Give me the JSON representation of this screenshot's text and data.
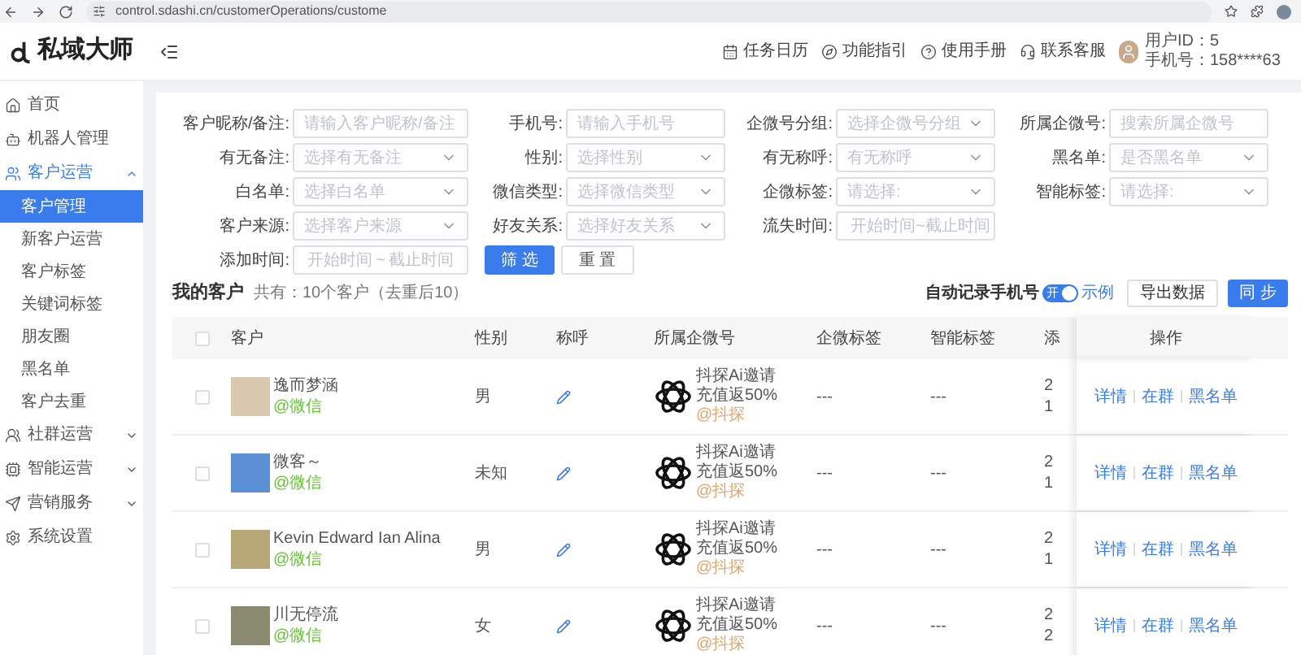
{
  "browser": {
    "url": "control.sdashi.cn/customerOperations/custome"
  },
  "header": {
    "logo": "私域大师",
    "links": [
      {
        "label": "任务日历"
      },
      {
        "label": "功能指引"
      },
      {
        "label": "使用手册"
      },
      {
        "label": "联系客服"
      }
    ],
    "user_id": "用户ID：5",
    "phone": "手机号：158****63"
  },
  "sidebar": {
    "items": [
      {
        "label": "首页",
        "selected": false
      },
      {
        "label": "机器人管理",
        "selected": false
      },
      {
        "label": "客户运营",
        "expanded": true,
        "selected": false,
        "children": [
          {
            "label": "客户管理",
            "selected": true
          },
          {
            "label": "新客户运营",
            "selected": false
          },
          {
            "label": "客户标签",
            "selected": false
          },
          {
            "label": "关键词标签",
            "selected": false
          },
          {
            "label": "朋友圈",
            "selected": false
          },
          {
            "label": "黑名单",
            "selected": false
          },
          {
            "label": "客户去重",
            "selected": false
          }
        ]
      },
      {
        "label": "社群运营",
        "expanded": false,
        "selected": false
      },
      {
        "label": "智能运营",
        "expanded": false,
        "selected": false
      },
      {
        "label": "营销服务",
        "expanded": false,
        "selected": false
      },
      {
        "label": "系统设置",
        "selected": false
      }
    ]
  },
  "filters": [
    [
      {
        "kind": "input",
        "label": "客户昵称/备注:",
        "placeholder": "请输入客户昵称/备注"
      },
      {
        "kind": "input",
        "label": "手机号:",
        "placeholder": "请输入手机号"
      },
      {
        "kind": "select",
        "label": "企微号分组:",
        "placeholder": "选择企微号分组"
      },
      {
        "kind": "input",
        "label": "所属企微号:",
        "placeholder": "搜索所属企微号"
      }
    ],
    [
      {
        "kind": "select",
        "label": "有无备注:",
        "placeholder": "选择有无备注"
      },
      {
        "kind": "select",
        "label": "性别:",
        "placeholder": "选择性别"
      },
      {
        "kind": "select",
        "label": "有无称呼:",
        "placeholder": "有无称呼"
      },
      {
        "kind": "select",
        "label": "黑名单:",
        "placeholder": "是否黑名单"
      }
    ],
    [
      {
        "kind": "select",
        "label": "白名单:",
        "placeholder": "选择白名单"
      },
      {
        "kind": "select",
        "label": "微信类型:",
        "placeholder": "选择微信类型"
      },
      {
        "kind": "select",
        "label": "企微标签:",
        "placeholder": "请选择:"
      },
      {
        "kind": "select",
        "label": "智能标签:",
        "placeholder": "请选择:"
      }
    ],
    [
      {
        "kind": "select",
        "label": "客户来源:",
        "placeholder": "选择客户来源"
      },
      {
        "kind": "select",
        "label": "好友关系:",
        "placeholder": "选择好友关系"
      },
      {
        "kind": "range",
        "label": "流失时间:",
        "start": "开始时间",
        "sep": "~",
        "end": "截止时间"
      }
    ],
    [
      {
        "kind": "range",
        "label": "添加时间:",
        "start": "开始时间",
        "sep": "~",
        "end": "截止时间"
      }
    ]
  ],
  "filter_buttons": {
    "search": "筛 选",
    "reset": "重 置"
  },
  "list": {
    "title": "我的客户",
    "count": "共有：10个客户（去重后10）",
    "auto_record": "自动记录手机号",
    "switch": {
      "on": true,
      "label": "开"
    },
    "example": "示例",
    "export": "导出数据",
    "sync": "同 步"
  },
  "table": {
    "select_all": {
      "checked": false
    },
    "columns": [
      "客户",
      "性别",
      "称呼",
      "所属企微号",
      "企微标签",
      "智能标签",
      "添",
      "操作"
    ],
    "rows": [
      {
        "checked": false,
        "name": "逸而梦涵",
        "source": "@微信",
        "gender": "男",
        "account": [
          "抖探Ai邀请",
          "充值返50%"
        ],
        "account_source": "@抖探",
        "wecom_tags": "---",
        "smart_tags": "---",
        "date": [
          "2",
          "1"
        ],
        "actions": [
          "详情",
          "在群",
          "黑名单"
        ]
      },
      {
        "checked": false,
        "name": "微客～",
        "source": "@微信",
        "gender": "未知",
        "account": [
          "抖探Ai邀请",
          "充值返50%"
        ],
        "account_source": "@抖探",
        "wecom_tags": "---",
        "smart_tags": "---",
        "date": [
          "2",
          "1"
        ],
        "actions": [
          "详情",
          "在群",
          "黑名单"
        ]
      },
      {
        "checked": false,
        "name": "Kevin Edward Ian Alina",
        "source": "@微信",
        "gender": "男",
        "account": [
          "抖探Ai邀请",
          "充值返50%"
        ],
        "account_source": "@抖探",
        "wecom_tags": "---",
        "smart_tags": "---",
        "date": [
          "2",
          "1"
        ],
        "actions": [
          "详情",
          "在群",
          "黑名单"
        ]
      },
      {
        "checked": false,
        "name": "川无停流",
        "source": "@微信",
        "gender": "女",
        "account": [
          "抖探Ai邀请",
          "充值返50%"
        ],
        "account_source": "@抖探",
        "wecom_tags": "---",
        "smart_tags": "---",
        "date": [
          "2",
          "2"
        ],
        "actions": [
          "详情",
          "在群",
          "黑名单"
        ]
      }
    ]
  }
}
